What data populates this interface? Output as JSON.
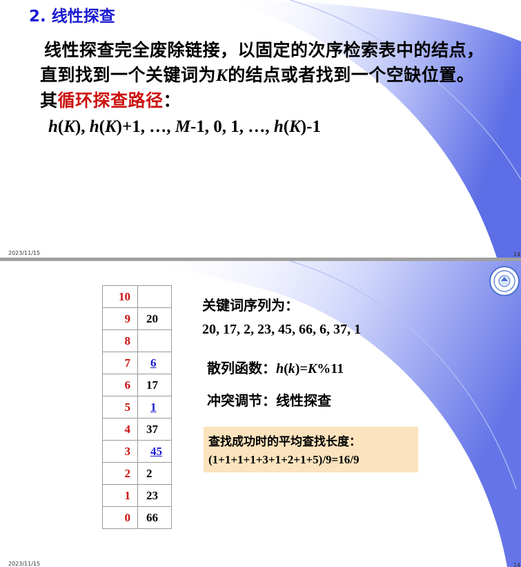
{
  "slide1": {
    "title": "2. 线性探查",
    "para_line1": "线性探查完全废除链接，以固定的次序检索表中的结点，",
    "para_line2_pre": "直到找到一个关键词为",
    "para_line2_var": "K",
    "para_line2_post": "的结点或者找到一个空缺位置。",
    "para_line3_pre": "其",
    "para_line3_red": "循环探查路径",
    "para_line3_post": "：",
    "formula": {
      "p1": "h",
      "p2": "(",
      "p3": "K",
      "p4": "), ",
      "p5": "h",
      "p6": "(",
      "p7": "K",
      "p8": ")+1, …, ",
      "p9": "M",
      "p10": "-1, 0, 1, …, ",
      "p11": "h",
      "p12": "(",
      "p13": "K",
      "p14": ")-1"
    },
    "footer_date": "2023/11/15",
    "footer_page": "14"
  },
  "slide2": {
    "table": [
      {
        "index": "10",
        "value": ""
      },
      {
        "index": "9",
        "value": "20"
      },
      {
        "index": "8",
        "value": ""
      },
      {
        "index": "7",
        "value": "6",
        "link": true
      },
      {
        "index": "6",
        "value": "17"
      },
      {
        "index": "5",
        "value": "1",
        "link": true
      },
      {
        "index": "4",
        "value": "37"
      },
      {
        "index": "3",
        "value": "45",
        "link": true
      },
      {
        "index": "2",
        "value": "2"
      },
      {
        "index": "1",
        "value": "23"
      },
      {
        "index": "0",
        "value": "66"
      }
    ],
    "keys_label": "关键词序列为：",
    "keys_values": "20, 17, 2, 23, 45, 66, 6, 37, 1",
    "hash_label": "散列函数：",
    "hash_h": "h",
    "hash_open": "(",
    "hash_k": "k",
    "hash_close": ")=",
    "hash_K": "K",
    "hash_rest": "%11",
    "collision_label": "冲突调节：线性探查",
    "box_line1": "查找成功时的平均查找长度：",
    "box_line2": "(1+1+1+1+3+1+2+1+5)/9=16/9",
    "footer_date": "2023/11/15",
    "footer_page": "14"
  },
  "colors": {
    "title_blue": "#1a1ad0",
    "red": "#cc1111",
    "box_bg": "#fbe3bd",
    "swoosh": "#6f7fe8"
  }
}
